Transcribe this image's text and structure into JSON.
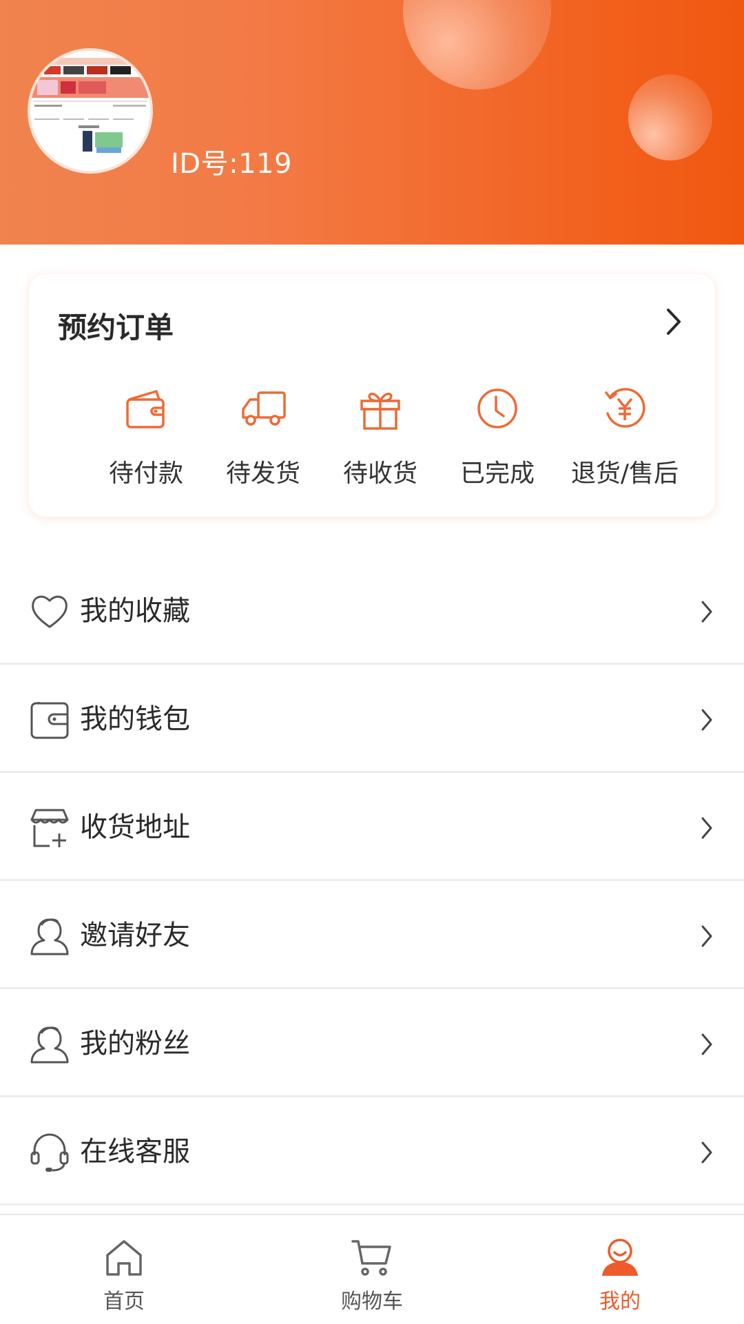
{
  "header": {
    "user_id_text": "ID号:119",
    "brand_color": "#f26a2e"
  },
  "orders": {
    "title": "预约订单",
    "items": [
      {
        "label": "待付款",
        "icon": "wallet-icon"
      },
      {
        "label": "待发货",
        "icon": "truck-icon"
      },
      {
        "label": "待收货",
        "icon": "gift-icon"
      },
      {
        "label": "已完成",
        "icon": "clock-icon"
      },
      {
        "label": "退货/售后",
        "icon": "refund-yen-icon"
      }
    ]
  },
  "menu": {
    "items": [
      {
        "label": "我的收藏",
        "icon": "heart-icon"
      },
      {
        "label": "我的钱包",
        "icon": "wallet-icon"
      },
      {
        "label": "收货地址",
        "icon": "store-add-icon"
      },
      {
        "label": "邀请好友",
        "icon": "user-icon"
      },
      {
        "label": "我的粉丝",
        "icon": "user-icon"
      },
      {
        "label": "在线客服",
        "icon": "headset-icon"
      }
    ]
  },
  "tabbar": {
    "items": [
      {
        "label": "首页",
        "icon": "home-icon"
      },
      {
        "label": "购物车",
        "icon": "cart-icon"
      },
      {
        "label": "我的",
        "icon": "profile-icon",
        "active": true
      }
    ],
    "active_color": "#ee5a2a"
  }
}
